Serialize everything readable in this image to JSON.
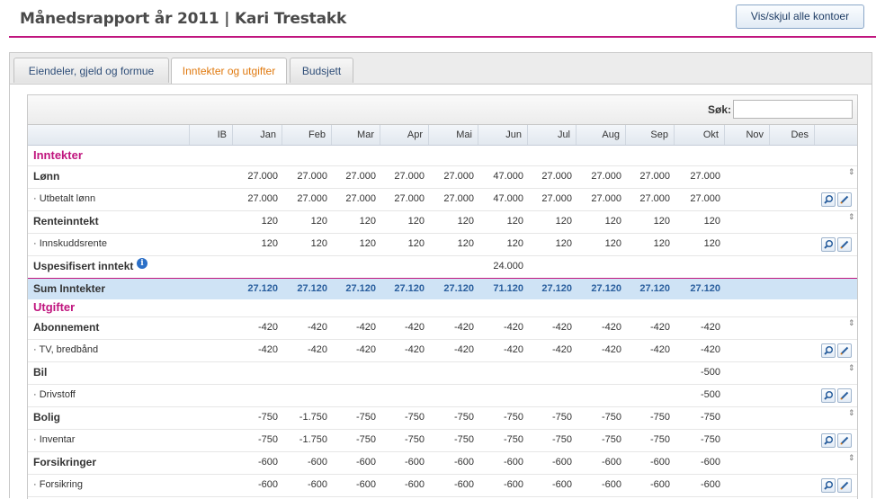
{
  "header": {
    "title": "Månedsrapport år 2011 | Kari Trestakk",
    "toggle_button": "Vis/skjul alle kontoer",
    "accent_color": "#c0157e"
  },
  "tabs": [
    {
      "label": "Eiendeler, gjeld og formue",
      "active": false
    },
    {
      "label": "Inntekter og utgifter",
      "active": true
    },
    {
      "label": "Budsjett",
      "active": false
    }
  ],
  "search": {
    "label": "Søk:",
    "value": ""
  },
  "columns": [
    "IB",
    "Jan",
    "Feb",
    "Mar",
    "Apr",
    "Mai",
    "Jun",
    "Jul",
    "Aug",
    "Sep",
    "Okt",
    "Nov",
    "Des"
  ],
  "rows": [
    {
      "kind": "section",
      "label": "Inntekter",
      "values": []
    },
    {
      "kind": "group",
      "label": "Lønn",
      "values": [
        "",
        "27.000",
        "27.000",
        "27.000",
        "27.000",
        "27.000",
        "47.000",
        "27.000",
        "27.000",
        "27.000",
        "27.000",
        "",
        ""
      ],
      "sort_icon": "sort-icon"
    },
    {
      "kind": "sub",
      "label": "· Utbetalt lønn",
      "values": [
        "",
        "27.000",
        "27.000",
        "27.000",
        "27.000",
        "27.000",
        "47.000",
        "27.000",
        "27.000",
        "27.000",
        "27.000",
        "",
        ""
      ],
      "actions": [
        "search-icon",
        "edit-icon"
      ]
    },
    {
      "kind": "group",
      "label": "Renteinntekt",
      "values": [
        "",
        "120",
        "120",
        "120",
        "120",
        "120",
        "120",
        "120",
        "120",
        "120",
        "120",
        "",
        ""
      ],
      "sort_icon": "sort-icon"
    },
    {
      "kind": "sub",
      "label": "· Innskuddsrente",
      "values": [
        "",
        "120",
        "120",
        "120",
        "120",
        "120",
        "120",
        "120",
        "120",
        "120",
        "120",
        "",
        ""
      ],
      "actions": [
        "search-icon",
        "edit-icon"
      ]
    },
    {
      "kind": "group",
      "label": "Uspesifisert inntekt",
      "info": "i",
      "values": [
        "",
        "",
        "",
        "",
        "",
        "",
        "24.000",
        "",
        "",
        "",
        "",
        "",
        ""
      ]
    },
    {
      "kind": "sum",
      "label": "Sum Inntekter",
      "values": [
        "",
        "27.120",
        "27.120",
        "27.120",
        "27.120",
        "27.120",
        "71.120",
        "27.120",
        "27.120",
        "27.120",
        "27.120",
        "",
        ""
      ]
    },
    {
      "kind": "section",
      "label": "Utgifter",
      "values": []
    },
    {
      "kind": "group",
      "label": "Abonnement",
      "values": [
        "",
        "-420",
        "-420",
        "-420",
        "-420",
        "-420",
        "-420",
        "-420",
        "-420",
        "-420",
        "-420",
        "",
        ""
      ],
      "sort_icon": "sort-icon"
    },
    {
      "kind": "sub",
      "label": "· TV, bredbånd",
      "values": [
        "",
        "-420",
        "-420",
        "-420",
        "-420",
        "-420",
        "-420",
        "-420",
        "-420",
        "-420",
        "-420",
        "",
        ""
      ],
      "actions": [
        "search-icon",
        "edit-icon"
      ]
    },
    {
      "kind": "group",
      "label": "Bil",
      "values": [
        "",
        "",
        "",
        "",
        "",
        "",
        "",
        "",
        "",
        "",
        "-500",
        "",
        ""
      ],
      "sort_icon": "sort-icon"
    },
    {
      "kind": "sub",
      "label": "· Drivstoff",
      "values": [
        "",
        "",
        "",
        "",
        "",
        "",
        "",
        "",
        "",
        "",
        "-500",
        "",
        ""
      ],
      "actions": [
        "search-icon",
        "edit-icon"
      ]
    },
    {
      "kind": "group",
      "label": "Bolig",
      "values": [
        "",
        "-750",
        "-1.750",
        "-750",
        "-750",
        "-750",
        "-750",
        "-750",
        "-750",
        "-750",
        "-750",
        "",
        ""
      ],
      "sort_icon": "sort-icon"
    },
    {
      "kind": "sub",
      "label": "· Inventar",
      "values": [
        "",
        "-750",
        "-1.750",
        "-750",
        "-750",
        "-750",
        "-750",
        "-750",
        "-750",
        "-750",
        "-750",
        "",
        ""
      ],
      "actions": [
        "search-icon",
        "edit-icon"
      ]
    },
    {
      "kind": "group",
      "label": "Forsikringer",
      "values": [
        "",
        "-600",
        "-600",
        "-600",
        "-600",
        "-600",
        "-600",
        "-600",
        "-600",
        "-600",
        "-600",
        "",
        ""
      ],
      "sort_icon": "sort-icon"
    },
    {
      "kind": "sub",
      "label": "· Forsikring",
      "values": [
        "",
        "-600",
        "-600",
        "-600",
        "-600",
        "-600",
        "-600",
        "-600",
        "-600",
        "-600",
        "-600",
        "",
        ""
      ],
      "actions": [
        "search-icon",
        "edit-icon"
      ]
    }
  ]
}
